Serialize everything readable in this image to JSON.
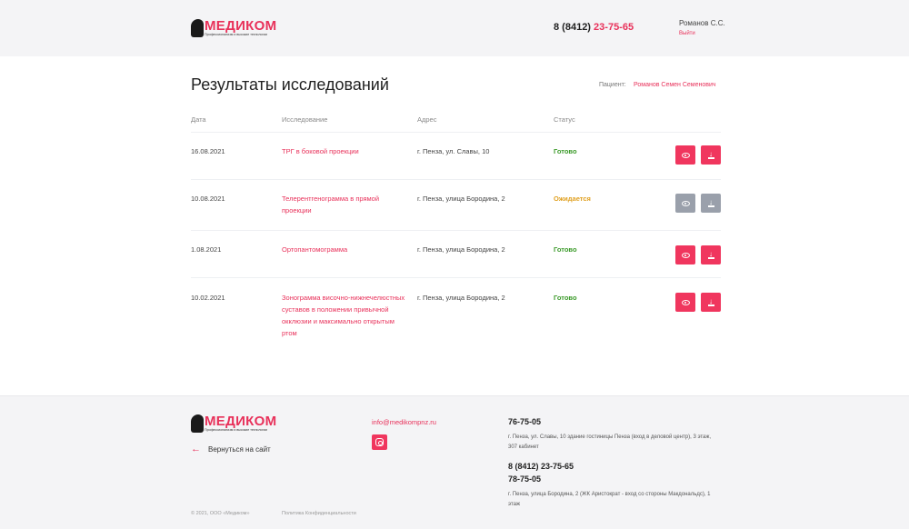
{
  "brand": {
    "name": "МЕДИКОМ",
    "tagline": "Профессионализм и высокие технологии",
    "accent_color": "#e8315a",
    "button_gray": "#9aa0ab"
  },
  "header": {
    "phone_prefix": "8 (8412)",
    "phone_number": "23-75-65",
    "user_name": "Романов С.С.",
    "logout_label": "Выйти"
  },
  "main": {
    "title": "Результаты исследований",
    "patient_label": "Пациент:",
    "patient_name": "Романов Семен Семенович",
    "columns": [
      "Дата",
      "Исследование",
      "Адрес",
      "Статус"
    ],
    "rows": [
      {
        "date": "16.08.2021",
        "study": "ТРГ в боковой проекции",
        "address": "г. Пенза, ул. Славы, 10",
        "status": "Готово",
        "status_color": "#3b9a2a",
        "buttons_enabled": true
      },
      {
        "date": "10.08.2021",
        "study": "Телерентгенограмма в прямой проекции",
        "address": "г. Пенза, улица Бородина, 2",
        "status": "Ожидается",
        "status_color": "#e0a020",
        "buttons_enabled": false
      },
      {
        "date": "1.08.2021",
        "study": "Ортопантомограмма",
        "address": "г. Пенза, улица Бородина, 2",
        "status": "Готово",
        "status_color": "#3b9a2a",
        "buttons_enabled": true
      },
      {
        "date": "10.02.2021",
        "study": "Зонограмма височно-нижнечелюстных суставов в положении привычной окклюзии и максимально открытым ртом",
        "address": "г. Пенза, улица Бородина, 2",
        "status": "Готово",
        "status_color": "#3b9a2a",
        "buttons_enabled": true
      }
    ],
    "view_icon": "eye-icon",
    "download_icon": "download-icon"
  },
  "footer": {
    "back_label": "Вернуться на сайт",
    "email": "info@medikompnz.ru",
    "instagram_icon": "instagram-icon",
    "phone1": "76-75-05",
    "address1": "г. Пенза, ул. Славы, 10 здание гостиницы Пенза (вход в деловой центр), 3 этаж, 307 кабинет",
    "phone2": "8 (8412) 23-75-65",
    "phone3": "78-75-05",
    "address2": "г. Пенза, улица Бородина, 2 (ЖК Аристократ - вход со стороны Макдональдс), 1 этаж",
    "copyright": "© 2021, ООО «Медиком»",
    "policy_label": "Политика Конфиденциальности"
  }
}
